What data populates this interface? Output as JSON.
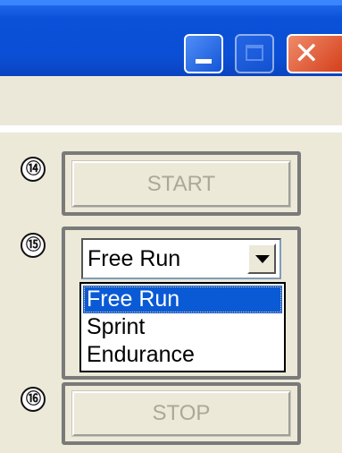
{
  "titlebar": {
    "minimize_icon": "minimize-icon",
    "maximize_icon": "maximize-icon",
    "close_icon": "close-icon",
    "close_glyph": "✕",
    "accent": "#0a50d8",
    "close_color": "#d5401c"
  },
  "callouts": {
    "start": "⑭",
    "mode": "⑮",
    "stop": "⑯"
  },
  "controls": {
    "start_label": "START",
    "stop_label": "STOP",
    "mode_selected": "Free Run",
    "mode_options": [
      "Free Run",
      "Sprint",
      "Endurance"
    ]
  }
}
